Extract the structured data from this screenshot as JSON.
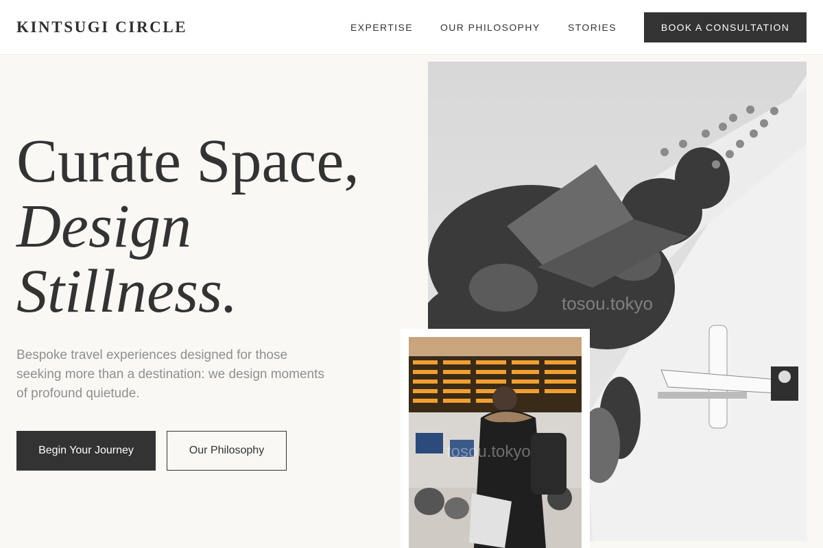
{
  "brand": "KINTSUGI CIRCLE",
  "nav": {
    "items": [
      "EXPERTISE",
      "OUR PHILOSOPHY",
      "STORIES"
    ],
    "cta_label": "BOOK A CONSULTATION"
  },
  "hero": {
    "title_line1": "Curate Space,",
    "title_line2": "Design",
    "title_line3": "Stillness.",
    "subtitle": "Bespoke travel experiences designed for those seeking more than a destination: we design moments of profound quietude.",
    "primary_button": "Begin Your Journey",
    "secondary_button": "Our Philosophy"
  },
  "images": {
    "main_watermark": "tosou.tokyo",
    "airport_watermark": "tosou.tokyo"
  },
  "colors": {
    "background": "#f9f8f5",
    "header_bg": "#ffffff",
    "dark": "#333333",
    "muted_text": "#8f8f8f"
  }
}
